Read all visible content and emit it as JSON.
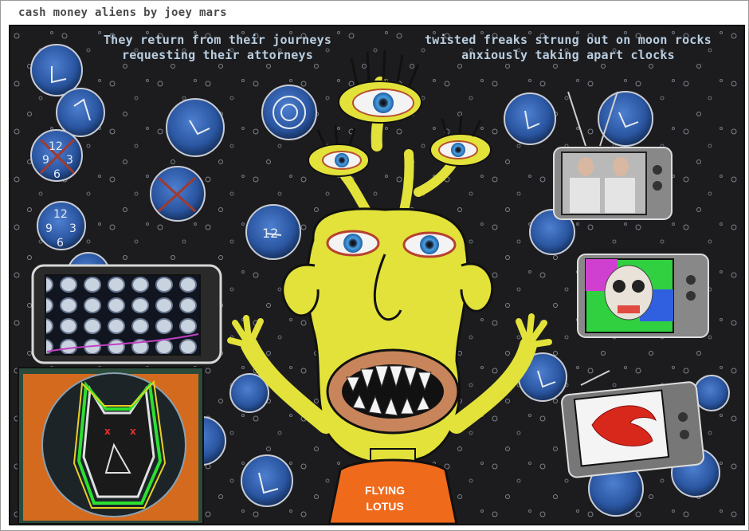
{
  "page": {
    "title": "cash money aliens by joey mars"
  },
  "artwork": {
    "caption_left_line1": "They return from their journeys",
    "caption_left_line2": "requesting their attorneys",
    "caption_right_line1": "twisted freaks strung out on moon rocks",
    "caption_right_line2": "anxiously taking apart clocks",
    "shirt_line1": "FLYING",
    "shirt_line2": "LOTUS",
    "colors": {
      "background": "#1c1c1e",
      "alien_skin": "#e2e23a",
      "clock_blue": "#2f5fae",
      "shirt": "#f06a1c",
      "caption": "#b9cde0"
    }
  }
}
